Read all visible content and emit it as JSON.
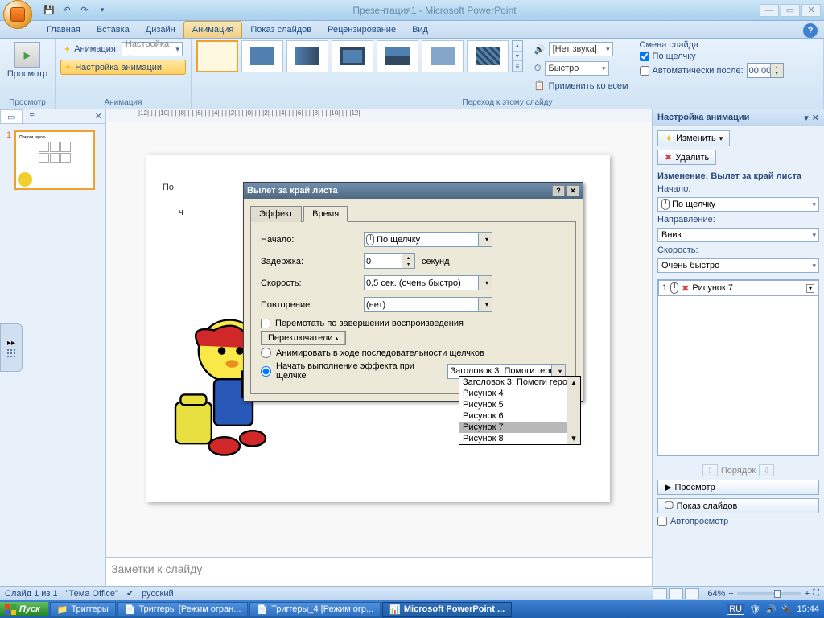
{
  "title": "Презентация1 - Microsoft PowerPoint",
  "tabs": [
    "Главная",
    "Вставка",
    "Дизайн",
    "Анимация",
    "Показ слайдов",
    "Рецензирование",
    "Вид"
  ],
  "active_tab": "Анимация",
  "ribbon": {
    "preview_group": "Просмотр",
    "preview_btn": "Просмотр",
    "anim_group": "Анимация",
    "anim_label": "Анимация:",
    "anim_value": "Настройка ...",
    "custom_anim_btn": "Настройка анимации",
    "transition_group": "Переход к этому слайду",
    "sound_label": "[Нет звука]",
    "speed_label": "Быстро",
    "apply_all": "Применить ко всем",
    "slide_change_label": "Смена слайда",
    "on_click": "По щелчку",
    "auto_after": "Автоматически после:",
    "auto_time": "00:00"
  },
  "slide": {
    "title_visible": "По",
    "subtitle_visible": "ч",
    "notes_placeholder": "Заметки к слайду"
  },
  "animpane": {
    "title": "Настройка анимации",
    "change_btn": "Изменить",
    "delete_btn": "Удалить",
    "effect_label": "Изменение: Вылет за край листа",
    "start_label": "Начало:",
    "start_value": "По щелчку",
    "direction_label": "Направление:",
    "direction_value": "Вниз",
    "speed_label": "Скорость:",
    "speed_value": "Очень быстро",
    "list_item": {
      "num": "1",
      "name": "Рисунок 7"
    },
    "reorder": "Порядок",
    "preview": "Просмотр",
    "slideshow": "Показ слайдов",
    "autopreview": "Автопросмотр"
  },
  "dialog": {
    "title": "Вылет за край листа",
    "tab_effect": "Эффект",
    "tab_time": "Время",
    "start_label": "Начало:",
    "start_value": "По щелчку",
    "delay_label": "Задержка:",
    "delay_value": "0",
    "delay_unit": "секунд",
    "speed_label": "Скорость:",
    "speed_value": "0,5 сек. (очень быстро)",
    "repeat_label": "Повторение:",
    "repeat_value": "(нет)",
    "rewind": "Перемотать по завершении воспроизведения",
    "triggers_btn": "Переключатели",
    "radio1": "Анимировать в ходе последовательности щелчков",
    "radio2": "Начать выполнение эффекта при щелчке",
    "trigger_value": "Заголовок 3: Помоги геро",
    "dropdown_items": [
      "Заголовок 3: Помоги геро",
      "Рисунок 4",
      "Рисунок 5",
      "Рисунок 6",
      "Рисунок 7",
      "Рисунок 8"
    ],
    "dropdown_selected": "Рисунок 7"
  },
  "statusbar": {
    "slide": "Слайд 1 из 1",
    "theme": "\"Тema Office\"",
    "theme_ru": "\"Тема Office\"",
    "lang": "русский",
    "zoom": "64%"
  },
  "taskbar": {
    "start": "Пуск",
    "items": [
      "Триггеры",
      "Триггеры [Режим огран...",
      "Триггеры_4 [Режим огр...",
      "Microsoft PowerPoint ..."
    ],
    "lang": "RU",
    "time": "15:44"
  },
  "ruler": "|12|·|·|·|10|·|·|·|8|·|·|·|6|·|·|·|4|·|·|·|2|·|·|·|0|·|·|·|2|·|·|·|4|·|·|·|6|·|·|·|8|·|·|·|10|·|·|·|12|"
}
